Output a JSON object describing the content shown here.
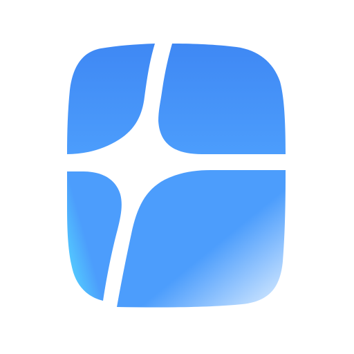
{
  "app_icon": {
    "icon": "four-pane-window-sparkle-icon",
    "background_color": "#ffffff",
    "gradient": {
      "top": "#3f88f4",
      "mid_left": "#4c9dfc",
      "bottom_left": "#56d8ff",
      "bottom_right": "#cfe6ff"
    }
  }
}
